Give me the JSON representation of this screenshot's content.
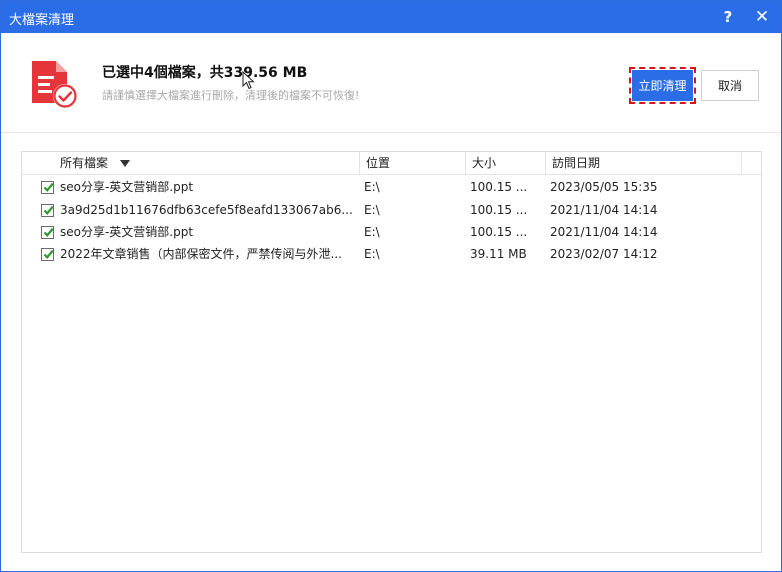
{
  "window": {
    "title": "大檔案清理",
    "help_label": "?",
    "close_label": "✕"
  },
  "header": {
    "summary": "已選中4個檔案，共339.56 MB",
    "warning": "請謹慎選擇大檔案進行刪除，清理後的檔案不可恢復!",
    "primary_button": "立即清理",
    "cancel_button": "取消",
    "icon": "document-check-icon"
  },
  "table": {
    "columns": {
      "name": "所有檔案",
      "location": "位置",
      "size": "大小",
      "date": "訪問日期"
    },
    "rows": [
      {
        "checked": true,
        "name": "seo分享-英文营销部.ppt",
        "location": "E:\\",
        "size": "100.15 ...",
        "date": "2023/05/05 15:35"
      },
      {
        "checked": true,
        "name": "3a9d25d1b11676dfb63cefe5f8eafd133067ab6...",
        "location": "E:\\",
        "size": "100.15 ...",
        "date": "2021/11/04 14:14"
      },
      {
        "checked": true,
        "name": "seo分享-英文营销部.ppt",
        "location": "E:\\",
        "size": "100.15 ...",
        "date": "2021/11/04 14:14"
      },
      {
        "checked": true,
        "name": "2022年文章销售（内部保密文件，严禁传阅与外泄...",
        "location": "E:\\",
        "size": "39.11 MB",
        "date": "2023/02/07 14:12"
      }
    ]
  },
  "colors": {
    "accent": "#2b6de6",
    "icon_red": "#e5343a",
    "highlight_dash": "#d7141a",
    "check_green": "#2e9a2e"
  }
}
